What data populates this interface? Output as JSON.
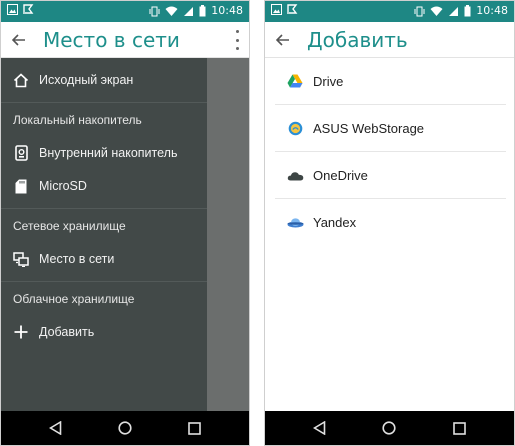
{
  "status": {
    "time": "10:48"
  },
  "left": {
    "title": "Место в сети",
    "items": {
      "home": "Исходный экран",
      "local_section": "Локальный накопитель",
      "internal": "Внутренний накопитель",
      "microsd": "MicroSD",
      "network_section": "Сетевое хранилище",
      "network_place": "Место в сети",
      "cloud_section": "Облачное хранилище",
      "add": "Добавить"
    }
  },
  "right": {
    "title": "Добавить",
    "services": [
      "Drive",
      "ASUS WebStorage",
      "OneDrive",
      "Yandex"
    ]
  },
  "colors": {
    "accent": "#1e8784",
    "title": "#1e8f8b",
    "drawer": "#424948"
  }
}
